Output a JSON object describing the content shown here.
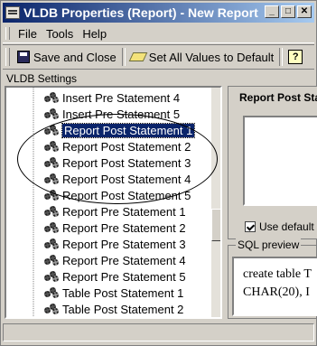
{
  "window": {
    "title": "VLDB Properties (Report) - New Report",
    "min": "_",
    "max": "□",
    "close": "✕"
  },
  "menu": [
    "File",
    "Tools",
    "Help"
  ],
  "toolbar": {
    "save_close": "Save and Close",
    "set_defaults": "Set All Values to Default",
    "help": "?"
  },
  "section_label": "VLDB Settings",
  "tree_items": [
    {
      "label": "Insert Pre Statement 4",
      "selected": false
    },
    {
      "label": "Insert Pre Statement 5",
      "selected": false
    },
    {
      "label": "Report Post Statement 1",
      "selected": true
    },
    {
      "label": "Report Post Statement 2",
      "selected": false
    },
    {
      "label": "Report Post Statement 3",
      "selected": false
    },
    {
      "label": "Report Post Statement 4",
      "selected": false
    },
    {
      "label": "Report Post Statement 5",
      "selected": false
    },
    {
      "label": "Report Pre Statement 1",
      "selected": false
    },
    {
      "label": "Report Pre Statement 2",
      "selected": false
    },
    {
      "label": "Report Pre Statement 3",
      "selected": false
    },
    {
      "label": "Report Pre Statement 4",
      "selected": false
    },
    {
      "label": "Report Pre Statement 5",
      "selected": false
    },
    {
      "label": "Table Post Statement 1",
      "selected": false
    },
    {
      "label": "Table Post Statement 2",
      "selected": false
    }
  ],
  "right_panel": {
    "title": "Report Post Sta",
    "checkbox_label": "Use default i",
    "checkbox_checked": true
  },
  "sql_preview": {
    "label": "SQL preview",
    "lines": [
      "create table T",
      "CHAR(20), I"
    ]
  }
}
